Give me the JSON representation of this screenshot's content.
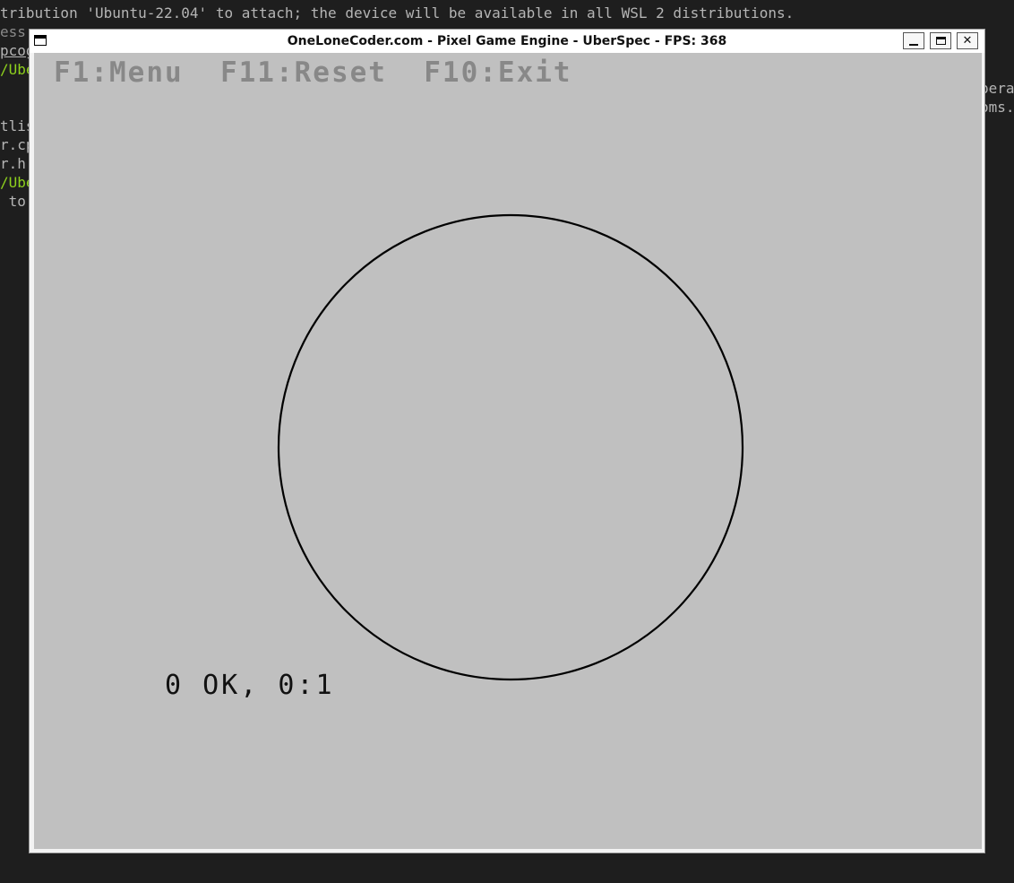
{
  "terminal": {
    "lines": [
      {
        "text": "tribution 'Ubuntu-22.04' to attach; the device will be available in all WSL 2 distributions.",
        "cls": ""
      },
      {
        "text": "ess",
        "cls": "dim"
      },
      {
        "text": "pcog",
        "cls": "underline"
      },
      {
        "text": "/Ube",
        "cls": "green"
      },
      {
        "text": "tlis",
        "cls": ""
      },
      {
        "text": "r.cp",
        "cls": ""
      },
      {
        "text": "r.h",
        "cls": ""
      },
      {
        "text": "/Ube",
        "cls": "green"
      },
      {
        "text": " to",
        "cls": ""
      }
    ],
    "right_lines": [
      "pera",
      "oms."
    ]
  },
  "window": {
    "title": "OneLoneCoder.com - Pixel Game Engine - UberSpec - FPS: 368",
    "minimize_icon": "minimize-icon",
    "maximize_icon": "maximize-icon",
    "close_glyph": "✕"
  },
  "game": {
    "menu_text": "F1:Menu  F11:Reset  F10:Exit",
    "status_text": "0 OK, 0:1",
    "colors": {
      "background": "#c0c0c0",
      "menu_text": "#888888",
      "circle": "#000000",
      "status_text": "#111111"
    }
  }
}
